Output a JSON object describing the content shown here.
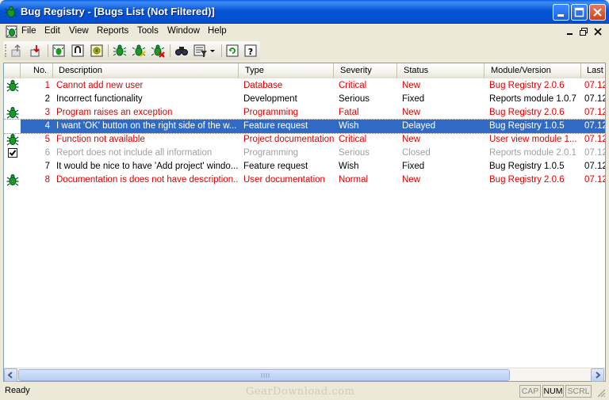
{
  "window": {
    "title": "Bug Registry - [Bugs List (Not Filtered)]"
  },
  "menu": {
    "items": [
      {
        "label": "File"
      },
      {
        "label": "Edit"
      },
      {
        "label": "View"
      },
      {
        "label": "Reports"
      },
      {
        "label": "Tools"
      },
      {
        "label": "Window"
      },
      {
        "label": "Help"
      }
    ]
  },
  "toolbar": {
    "icons": [
      "export-icon",
      "import-icon",
      "bug-report-icon",
      "bug-lock-icon",
      "bug-search-icon",
      "new-bug-icon",
      "edit-bug-icon",
      "delete-bug-icon",
      "find-icon",
      "filter-icon",
      "refresh-icon",
      "help-icon"
    ]
  },
  "columns": [
    {
      "label": "No."
    },
    {
      "label": "Description"
    },
    {
      "label": "Type"
    },
    {
      "label": "Severity"
    },
    {
      "label": "Status"
    },
    {
      "label": "Module/Version"
    },
    {
      "label": "Last"
    }
  ],
  "rows": [
    {
      "icon": "bug-icon",
      "no": "1",
      "description": "Cannot add new user",
      "type": "Database",
      "severity": "Critical",
      "status": "New",
      "module": "Bug Registry 2.0.6",
      "last": "07.12",
      "color": "#e00000",
      "selected": false
    },
    {
      "icon": "",
      "no": "2",
      "description": "Incorrect functionality",
      "type": "Development",
      "severity": "Serious",
      "status": "Fixed",
      "module": "Reports module 1.0.7",
      "last": "07.12",
      "color": "#000000",
      "selected": false
    },
    {
      "icon": "bug-icon",
      "no": "3",
      "description": "Program raises an exception",
      "type": "Programming",
      "severity": "Fatal",
      "status": "New",
      "module": "Bug Registry 2.0.6",
      "last": "07.12",
      "color": "#e00000",
      "selected": false
    },
    {
      "icon": "",
      "no": "4",
      "description": "I want 'OK' button on the right side of the w...",
      "type": "Feature request",
      "severity": "Wish",
      "status": "Delayed",
      "module": "Bug Registry 1.0.5",
      "last": "07.12",
      "color": "#ffffff",
      "selected": true
    },
    {
      "icon": "bug-icon",
      "no": "5",
      "description": "Function not available",
      "type": "Project documentation",
      "severity": "Critical",
      "status": "New",
      "module": "User view module 1...",
      "last": "07.12",
      "color": "#e00000",
      "selected": false
    },
    {
      "icon": "checkbox-icon",
      "no": "6",
      "description": "Report does not include all information",
      "type": "Programming",
      "severity": "Serious",
      "status": "Closed",
      "module": "Reports module 2.0.1",
      "last": "07.12",
      "color": "#a0a0a0",
      "selected": false
    },
    {
      "icon": "",
      "no": "7",
      "description": "It would be nice to have 'Add project' windo...",
      "type": "Feature request",
      "severity": "Wish",
      "status": "Fixed",
      "module": "Bug Registry 1.0.5",
      "last": "07.12",
      "color": "#000000",
      "selected": false
    },
    {
      "icon": "bug-icon",
      "no": "8",
      "description": "Documentation is does not have description...",
      "type": "User documentation",
      "severity": "Normal",
      "status": "New",
      "module": "Bug Registry 2.0.6",
      "last": "07.12",
      "color": "#e00000",
      "selected": false
    }
  ],
  "statusbar": {
    "text": "Ready",
    "indicators": [
      "CAP",
      "NUM",
      "SCRL"
    ]
  },
  "watermark": "GearDownload.com"
}
